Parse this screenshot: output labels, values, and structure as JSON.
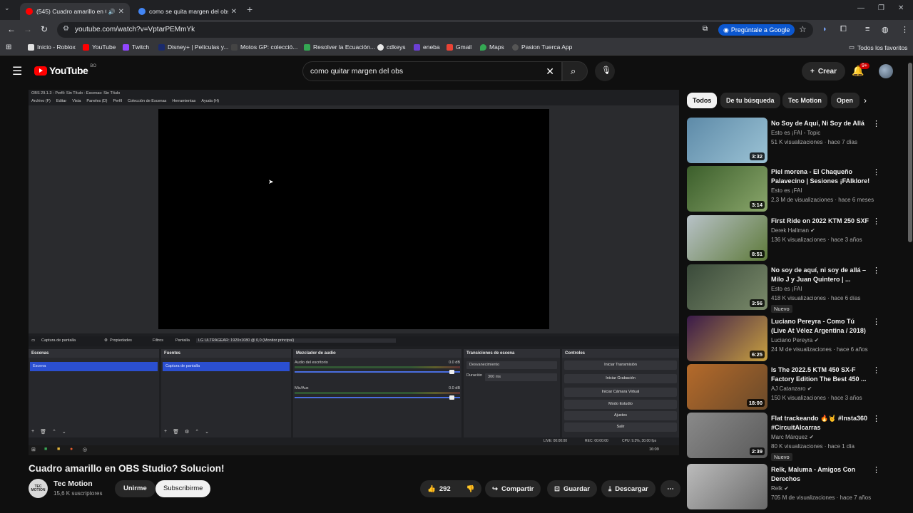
{
  "browser": {
    "tabs": [
      {
        "title": "(545) Cuadro amarillo en O",
        "audio": "🔊"
      },
      {
        "title": "como se quita margen del obs"
      }
    ],
    "url": "youtube.com/watch?v=VptarPEMmYk",
    "ask_google": "Pregúntale a Google",
    "bookmarks": [
      "Inicio - Roblox",
      "YouTube",
      "Twitch",
      "Disney+ | Películas y...",
      "Motos GP: colecció...",
      "Resolver la Ecuación...",
      "cdkeys",
      "eneba",
      "Gmail",
      "Maps",
      "Pasion Tuerca App"
    ],
    "all_bookmarks": "Todos los favoritos"
  },
  "masthead": {
    "logo": "YouTube",
    "country": "BO",
    "search_query": "como quitar margen del obs",
    "create_label": "Crear",
    "notif_count": "9+"
  },
  "obs": {
    "window_title": "OBS 29.1.3 - Perfil: Sin Título - Escenas: Sin Título",
    "menu": [
      "Archivo (F)",
      "Editar",
      "Vista",
      "Paneles (D)",
      "Perfil",
      "Colección de Escenas",
      "Herramientas",
      "Ayuda (H)"
    ],
    "source_bar": {
      "source": "Captura de pantalla",
      "properties": "Propiedades",
      "filters": "Filtros",
      "screen_label": "Pantalla",
      "screen_value": "LG ULTRAGEAR: 1920x1080 @ 0,0 (Monitor principal)"
    },
    "docks": {
      "scenes": {
        "title": "Escenas",
        "item": "Escena"
      },
      "sources": {
        "title": "Fuentes",
        "item": "Captura de pantalla"
      },
      "mixer": {
        "title": "Mezclador de audio",
        "ch1": "Audio del escritorio",
        "ch1_db": "0.0 dB",
        "ch2": "Mic/Aux",
        "ch2_db": "0.0 dB"
      },
      "transitions": {
        "title": "Transiciones de escena",
        "type": "Desvanecimiento",
        "duration_label": "Duración",
        "duration": "300 ms"
      },
      "controls": {
        "title": "Controles",
        "buttons": [
          "Iniciar Transmisión",
          "Iniciar Grabación",
          "Iniciar Cámara Virtual",
          "Modo Estudio",
          "Ajustes",
          "Salir"
        ]
      }
    },
    "status": {
      "live": "LIVE: 00:00:00",
      "rec": "REC: 00:00:00",
      "cpu": "CPU: 9.3%, 30.00 fps"
    },
    "clock": "16:09"
  },
  "video": {
    "title": "Cuadro amarillo en OBS Studio? Solucion!",
    "channel": "Tec Motion",
    "avatar_text": "TEC MOTION",
    "subscribers": "15,6 K suscriptores",
    "join": "Unirme",
    "subscribe": "Subscribirme",
    "likes": "292",
    "share": "Compartir",
    "save": "Guardar",
    "download": "Descargar"
  },
  "sidebar": {
    "chips": [
      "Todos",
      "De tu búsqueda",
      "Tec Motion",
      "Open"
    ],
    "items": [
      {
        "title": "No Soy de Aquí, Ni Soy de Allá",
        "channel": "Esto es ¡FAI - Topic",
        "meta": "51 K visualizaciones · hace 7 días",
        "duration": "3:32",
        "verified": false,
        "badge": ""
      },
      {
        "title": "Piel morena - El Chaqueño Palavecino | Sesiones ¡FAIklore!",
        "channel": "Esto es ¡FAI",
        "meta": "2,3 M de visualizaciones · hace 6 meses",
        "duration": "3:14",
        "verified": false,
        "badge": ""
      },
      {
        "title": "First Ride on 2022 KTM 250 SXF",
        "channel": "Derek Hallman",
        "meta": "136 K visualizaciones · hace 3 años",
        "duration": "8:51",
        "verified": true,
        "badge": ""
      },
      {
        "title": "No soy de aquí, ni soy de allá – Milo J y Juan Quintero | ...",
        "channel": "Esto es ¡FAI",
        "meta": "418 K visualizaciones · hace 6 días",
        "duration": "3:56",
        "verified": false,
        "badge": "Nuevo"
      },
      {
        "title": "Luciano Pereyra - Como Tú (Live At Vélez Argentina / 2018)",
        "channel": "Luciano Pereyra",
        "meta": "24 M de visualizaciones · hace 6 años",
        "duration": "6:25",
        "verified": true,
        "badge": ""
      },
      {
        "title": "Is The 2022.5 KTM 450 SX-F Factory Edition The Best 450 ...",
        "channel": "AJ Catanzaro",
        "meta": "150 K visualizaciones · hace 3 años",
        "duration": "18:00",
        "verified": true,
        "badge": ""
      },
      {
        "title": "Flat trackeando 🔥🤘 #Insta360 #CircuitAlcarras",
        "channel": "Marc Márquez",
        "meta": "80 K visualizaciones · hace 1 día",
        "duration": "2:39",
        "verified": true,
        "badge": "Nuevo"
      },
      {
        "title": "Relk, Maluma - Amigos Con Derechos",
        "channel": "Relk",
        "meta": "705 M de visualizaciones · hace 7 años",
        "duration": "",
        "verified": true,
        "badge": ""
      }
    ]
  },
  "colors": {
    "yt_bg": "#0f0f0f",
    "yt_red": "#ff0000",
    "obs_selection": "#2b4fd0",
    "chrome_accent": "#0b57d0"
  }
}
